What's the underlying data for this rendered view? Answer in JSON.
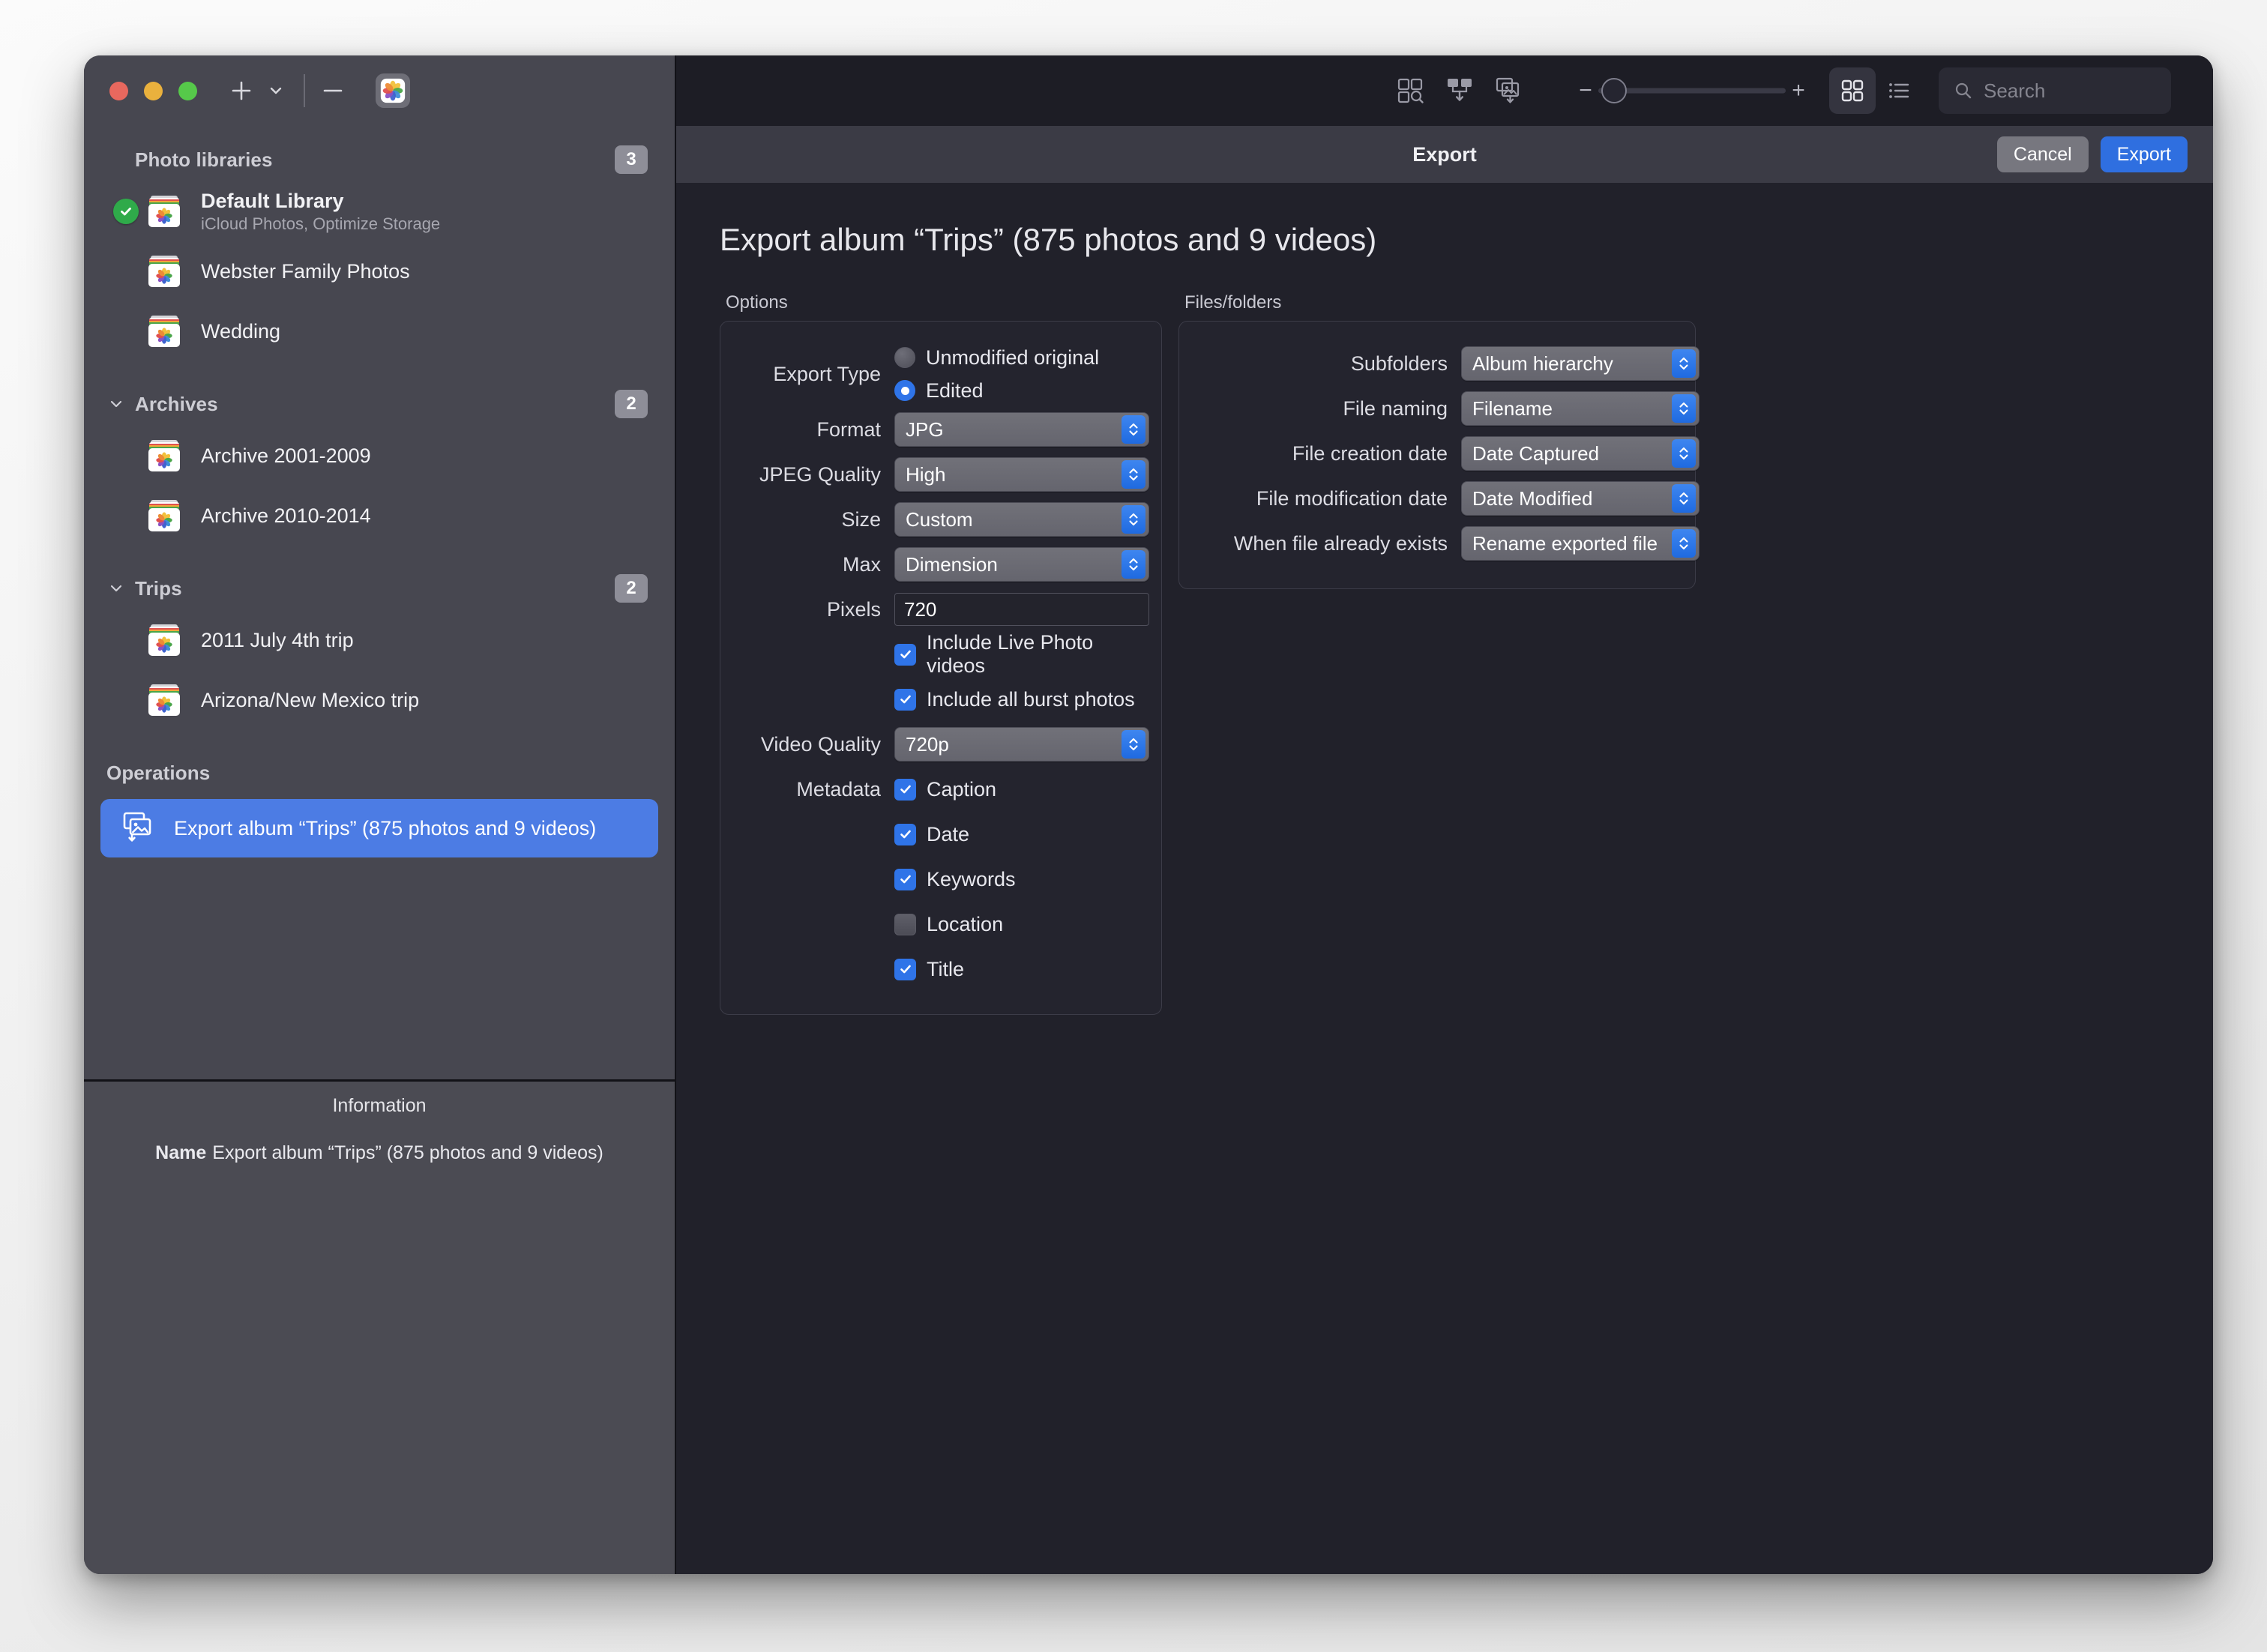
{
  "window": {
    "traffic_lights": [
      "close",
      "minimize",
      "zoom"
    ]
  },
  "sidebar_toolbar": {
    "add_label": "+",
    "add_menu_icon": "chevron-down-icon",
    "remove_label": "−",
    "app_icon": "photos-app-icon"
  },
  "sidebar": {
    "sections": [
      {
        "title": "Photo libraries",
        "count": "3",
        "collapsible": false,
        "items": [
          {
            "name": "Default Library",
            "subtitle": "iCloud Photos, Optimize Storage",
            "selected_check": true,
            "bold": true
          },
          {
            "name": "Webster Family Photos",
            "subtitle": "",
            "selected_check": false,
            "bold": false
          },
          {
            "name": "Wedding",
            "subtitle": "",
            "selected_check": false,
            "bold": false
          }
        ]
      },
      {
        "title": "Archives",
        "count": "2",
        "collapsible": true,
        "items": [
          {
            "name": "Archive 2001-2009",
            "subtitle": "",
            "selected_check": false,
            "bold": false
          },
          {
            "name": "Archive 2010-2014",
            "subtitle": "",
            "selected_check": false,
            "bold": false
          }
        ]
      },
      {
        "title": "Trips",
        "count": "2",
        "collapsible": true,
        "items": [
          {
            "name": "2011 July 4th trip",
            "subtitle": "",
            "selected_check": false,
            "bold": false
          },
          {
            "name": "Arizona/New Mexico trip",
            "subtitle": "",
            "selected_check": false,
            "bold": false
          }
        ]
      }
    ],
    "operations": {
      "title": "Operations",
      "selected_item": "Export album “Trips” (875 photos and 9 videos)",
      "selected_color": "#4c7ce4"
    },
    "information": {
      "title": "Information",
      "name_label": "Name",
      "name_value": "Export album “Trips” (875 photos and 9 videos)"
    }
  },
  "main_toolbar": {
    "icons": [
      "find-duplicates-icon",
      "merge-libraries-icon",
      "export-photos-icon"
    ],
    "zoom": {
      "minus_label": "−",
      "plus_label": "+",
      "value_percent": 0
    },
    "view_grid_icon": "grid-view-icon",
    "view_list_icon": "list-view-icon",
    "active_view": "grid",
    "search": {
      "placeholder": "Search",
      "value": "",
      "icon": "search-icon"
    }
  },
  "sheet": {
    "title": "Export",
    "cancel_label": "Cancel",
    "export_label": "Export",
    "accent_color": "#2f6fe0",
    "heading": "Export album “Trips” (875 photos and 9 videos)"
  },
  "options_panel": {
    "label": "Options",
    "export_type": {
      "label": "Export Type",
      "choices": [
        {
          "text": "Unmodified original",
          "selected": false
        },
        {
          "text": "Edited",
          "selected": true
        }
      ]
    },
    "format": {
      "label": "Format",
      "value": "JPG"
    },
    "jpeg_quality": {
      "label": "JPEG Quality",
      "value": "High"
    },
    "size": {
      "label": "Size",
      "value": "Custom"
    },
    "max": {
      "label": "Max",
      "value": "Dimension"
    },
    "pixels": {
      "label": "Pixels",
      "value": "720"
    },
    "include_live": {
      "text": "Include Live Photo videos",
      "checked": true
    },
    "include_burst": {
      "text": "Include all burst photos",
      "checked": true
    },
    "video_quality": {
      "label": "Video Quality",
      "value": "720p"
    },
    "metadata": {
      "label": "Metadata",
      "items": [
        {
          "text": "Caption",
          "checked": true
        },
        {
          "text": "Date",
          "checked": true
        },
        {
          "text": "Keywords",
          "checked": true
        },
        {
          "text": "Location",
          "checked": false
        },
        {
          "text": "Title",
          "checked": true
        }
      ]
    }
  },
  "files_panel": {
    "label": "Files/folders",
    "rows": [
      {
        "label": "Subfolders",
        "value": "Album hierarchy"
      },
      {
        "label": "File naming",
        "value": "Filename"
      },
      {
        "label": "File creation date",
        "value": "Date Captured"
      },
      {
        "label": "File modification date",
        "value": "Date Modified"
      },
      {
        "label": "When file already exists",
        "value": "Rename exported file"
      }
    ]
  }
}
